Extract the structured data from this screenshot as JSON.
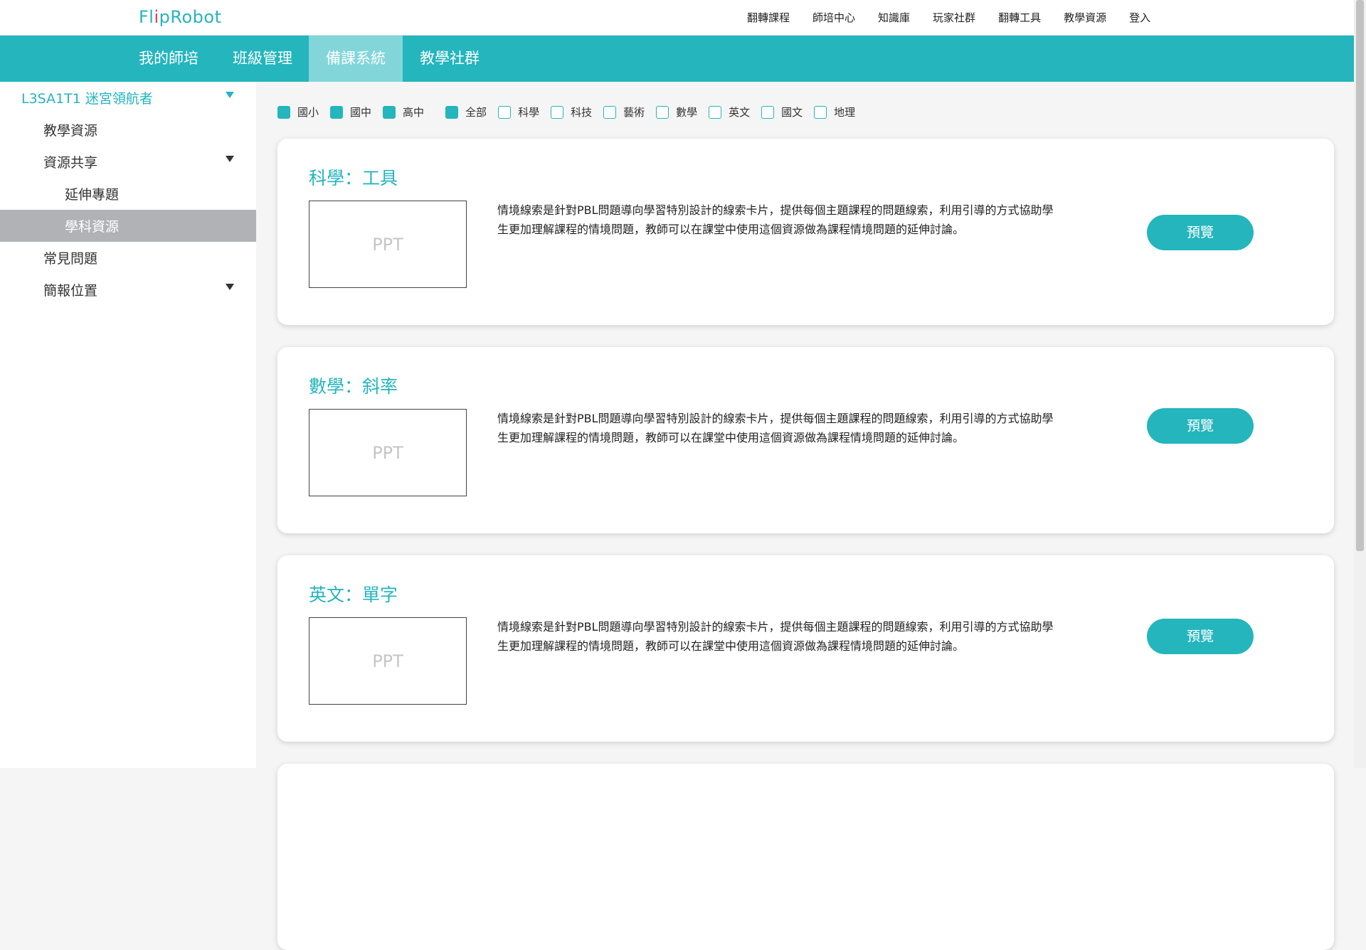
{
  "brand": {
    "logo_pre": "Fl",
    "logo_dot": "i",
    "logo_post": "pRobot"
  },
  "topnav": [
    "翻轉課程",
    "師培中心",
    "知識庫",
    "玩家社群",
    "翻轉工具",
    "教學資源",
    "登入"
  ],
  "mainnav": [
    {
      "label": "我的師培"
    },
    {
      "label": "班級管理"
    },
    {
      "label": "備課系統",
      "active": true
    },
    {
      "label": "教學社群"
    }
  ],
  "sidebar": {
    "header": "L3SA1T1 迷宮領航者",
    "items": [
      {
        "label": "教學資源"
      },
      {
        "label": "資源共享",
        "arrow": true
      },
      {
        "label": "延伸專題",
        "sub": true
      },
      {
        "label": "學科資源",
        "sub": true,
        "selected": true
      },
      {
        "label": "常見問題"
      },
      {
        "label": "簡報位置",
        "arrow": true
      }
    ]
  },
  "filters": {
    "levels": [
      {
        "label": "國小",
        "checked": true
      },
      {
        "label": "國中",
        "checked": true
      },
      {
        "label": "高中",
        "checked": true
      }
    ],
    "subjects": [
      {
        "label": "全部",
        "checked": true
      },
      {
        "label": "科學",
        "checked": false
      },
      {
        "label": "科技",
        "checked": false
      },
      {
        "label": "藝術",
        "checked": false
      },
      {
        "label": "數學",
        "checked": false
      },
      {
        "label": "英文",
        "checked": false
      },
      {
        "label": "國文",
        "checked": false
      },
      {
        "label": "地理",
        "checked": false
      }
    ]
  },
  "cards": [
    {
      "title": "科學：工具",
      "thumb": "PPT",
      "desc": "情境線索是針對PBL問題導向學習特別設計的線索卡片，提供每個主題課程的問題線索，利用引導的方式協助學生更加理解課程的情境問題，教師可以在課堂中使用這個資源做為課程情境問題的延伸討論。",
      "button": "預覽"
    },
    {
      "title": "數學：斜率",
      "thumb": "PPT",
      "desc": "情境線索是針對PBL問題導向學習特別設計的線索卡片，提供每個主題課程的問題線索，利用引導的方式協助學生更加理解課程的情境問題，教師可以在課堂中使用這個資源做為課程情境問題的延伸討論。",
      "button": "預覽"
    },
    {
      "title": "英文：單字",
      "thumb": "PPT",
      "desc": "情境線索是針對PBL問題導向學習特別設計的線索卡片，提供每個主題課程的問題線索，利用引導的方式協助學生更加理解課程的情境問題，教師可以在課堂中使用這個資源做為課程情境問題的延伸討論。",
      "button": "預覽"
    }
  ],
  "colors": {
    "accent": "#24b5bd",
    "accent_light": "#82d6da",
    "selected_bg": "#b0b2b5",
    "logo_dot": "#e0424b"
  }
}
